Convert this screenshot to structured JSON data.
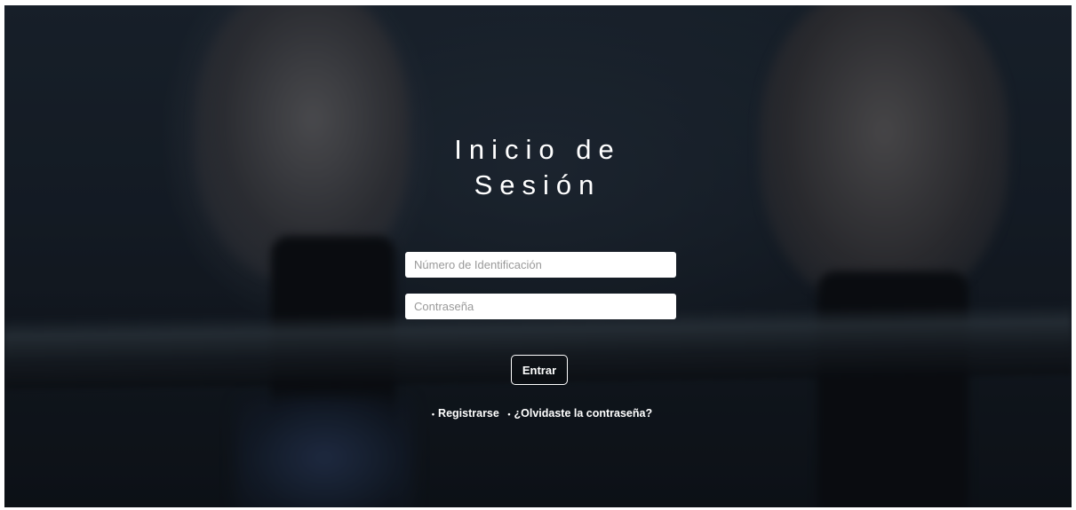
{
  "page": {
    "title_line1": "Inicio de",
    "title_line2": "Sesión"
  },
  "form": {
    "id_field": {
      "value": "",
      "placeholder": "Número de Identificación"
    },
    "password_field": {
      "value": "",
      "placeholder": "Contraseña"
    },
    "submit_label": "Entrar"
  },
  "links": {
    "bullet": "•",
    "register_label": "Registrarse",
    "forgot_label": "¿Olvidaste la contraseña?"
  },
  "colors": {
    "text": "#ffffff",
    "input_bg": "#ffffff",
    "background": "#131a22"
  }
}
